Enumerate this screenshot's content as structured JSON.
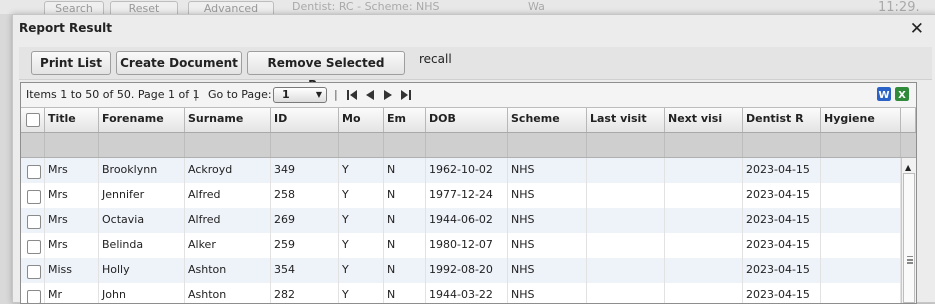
{
  "background": {
    "buttons": [
      "Search",
      "Reset",
      "Advanced"
    ],
    "info_text": "Dentist: RC - Scheme: NHS",
    "side_text_1": "Wa",
    "time_text": "11:29."
  },
  "dialog": {
    "title": "Report Result",
    "close_glyph": "✕"
  },
  "toolbar": {
    "print_list": "Print List",
    "create_document": "Create Document",
    "remove_rows": "Remove Selected Rows",
    "recall": "recall"
  },
  "pager": {
    "info": "Items 1 to 50 of 50. Page 1 of 1",
    "separator": "|",
    "goto_label": "Go to Page:",
    "page_value": "1"
  },
  "columns": [
    "Title",
    "Forename",
    "Surname",
    "ID",
    "Mo",
    "Em",
    "DOB",
    "Scheme",
    "Last visit",
    "Next visi",
    "Dentist R",
    "Hygiene"
  ],
  "rows": [
    {
      "title": "Mrs",
      "forename": "Brooklynn",
      "surname": "Ackroyd",
      "id": "349",
      "mo": "Y",
      "em": "N",
      "dob": "1962-10-02",
      "scheme": "NHS",
      "last": "",
      "next": "",
      "dentist": "2023-04-15",
      "hygiene": ""
    },
    {
      "title": "Mrs",
      "forename": "Jennifer",
      "surname": "Alfred",
      "id": "258",
      "mo": "Y",
      "em": "N",
      "dob": "1977-12-24",
      "scheme": "NHS",
      "last": "",
      "next": "",
      "dentist": "2023-04-15",
      "hygiene": ""
    },
    {
      "title": "Mrs",
      "forename": "Octavia",
      "surname": "Alfred",
      "id": "269",
      "mo": "Y",
      "em": "N",
      "dob": "1944-06-02",
      "scheme": "NHS",
      "last": "",
      "next": "",
      "dentist": "2023-04-15",
      "hygiene": ""
    },
    {
      "title": "Mrs",
      "forename": "Belinda",
      "surname": "Alker",
      "id": "259",
      "mo": "Y",
      "em": "N",
      "dob": "1980-12-07",
      "scheme": "NHS",
      "last": "",
      "next": "",
      "dentist": "2023-04-15",
      "hygiene": ""
    },
    {
      "title": "Miss",
      "forename": "Holly",
      "surname": "Ashton",
      "id": "354",
      "mo": "Y",
      "em": "N",
      "dob": "1992-08-20",
      "scheme": "NHS",
      "last": "",
      "next": "",
      "dentist": "2023-04-15",
      "hygiene": ""
    },
    {
      "title": "Mr",
      "forename": "John",
      "surname": "Ashton",
      "id": "282",
      "mo": "Y",
      "em": "N",
      "dob": "1944-03-22",
      "scheme": "NHS",
      "last": "",
      "next": "",
      "dentist": "2023-04-15",
      "hygiene": ""
    }
  ],
  "icons": {
    "word_export": "word-icon",
    "excel_export": "excel-icon",
    "first": "first-page-icon",
    "prev": "prev-page-icon",
    "next": "next-page-icon",
    "last": "last-page-icon"
  }
}
